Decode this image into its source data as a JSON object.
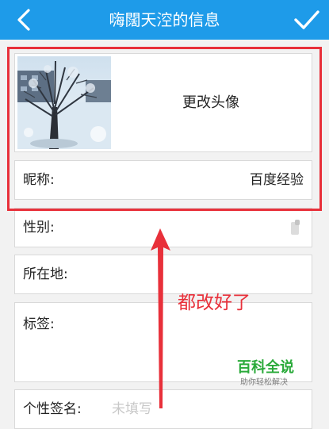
{
  "header": {
    "title": "嗨闊天涳的信息",
    "accent_color": "#1e9be9",
    "back_icon": "chevron-left-icon",
    "confirm_icon": "checkmark-icon"
  },
  "profile": {
    "avatar_label": "更改头像",
    "nickname_label": "昵称:",
    "nickname_value": "百度经验",
    "gender_label": "性别:",
    "location_label": "所在地:",
    "tags_label": "标签:",
    "signature_label": "个性签名:",
    "signature_placeholder": "未填写"
  },
  "overlay": {
    "annotation": "都改好了",
    "highlight_color": "#e8303a"
  },
  "watermark": {
    "main": "百科全说",
    "sub": "助你轻松解决"
  }
}
